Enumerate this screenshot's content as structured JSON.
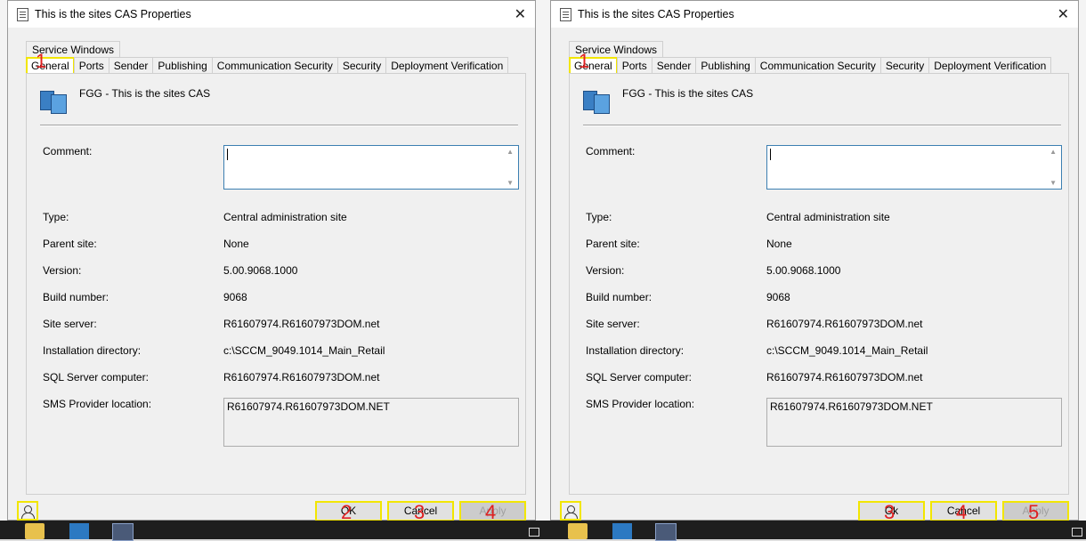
{
  "dialog": {
    "title": "This is the sites CAS Properties",
    "close_glyph": "✕",
    "tabs_row2": [
      "Service Windows"
    ],
    "tabs_row1": [
      "General",
      "Ports",
      "Sender",
      "Publishing",
      "Communication Security",
      "Security",
      "Deployment Verification"
    ],
    "active_tab": "General",
    "site_name": "FGG - This is the sites CAS",
    "fields": {
      "comment_label": "Comment:",
      "comment_value": "",
      "type_label": "Type:",
      "type_value": "Central administration site",
      "parent_label": "Parent site:",
      "parent_value": "None",
      "version_label": "Version:",
      "version_value": "5.00.9068.1000",
      "build_label": "Build number:",
      "build_value": "9068",
      "server_label": "Site server:",
      "server_value": "R61607974.R61607973DOM.net",
      "install_label": "Installation directory:",
      "install_value": "c:\\SCCM_9049.1014_Main_Retail",
      "sql_label": "SQL Server computer:",
      "sql_value": "R61607974.R61607973DOM.net",
      "sms_label": "SMS Provider location:",
      "sms_value": "R61607974.R61607973DOM.NET"
    },
    "buttons": {
      "ok": "OK",
      "ok_alt": "Ok",
      "cancel": "Cancel",
      "apply": "Apply"
    }
  },
  "annotations": {
    "left": [
      "1",
      "2",
      "3",
      "4"
    ],
    "right": [
      "1",
      "3",
      "4",
      "5"
    ]
  },
  "icons": [
    "window-icon",
    "close-icon",
    "site-server-icon",
    "user-help-icon",
    "folder-icon",
    "app-icon"
  ],
  "colors": {
    "highlight": "#f2e600",
    "marker": "#e02020",
    "focus": "#0078d7"
  }
}
